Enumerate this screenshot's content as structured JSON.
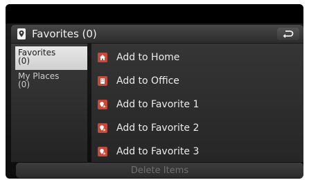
{
  "header": {
    "title": "Favorites (0)",
    "pin_icon": "map-pin-icon",
    "back_icon": "back-arrow-icon"
  },
  "sidebar": {
    "items": [
      {
        "label": "Favorites",
        "count": "(0)",
        "active": true
      },
      {
        "label": "My Places",
        "count": "(0)",
        "active": false
      }
    ]
  },
  "list": {
    "items": [
      {
        "label": "Add to Home",
        "icon": "home-icon"
      },
      {
        "label": "Add to Office",
        "icon": "office-icon"
      },
      {
        "label": "Add to Favorite 1",
        "icon": "favorite-pin-icon"
      },
      {
        "label": "Add to Favorite 2",
        "icon": "favorite-pin-icon"
      },
      {
        "label": "Add to Favorite 3",
        "icon": "favorite-pin-icon"
      }
    ]
  },
  "footer": {
    "delete_label": "Delete Items"
  },
  "colors": {
    "icon_red": "#c8483c",
    "active_tab": "#dcdcdc",
    "background": "#1a1a1a"
  }
}
